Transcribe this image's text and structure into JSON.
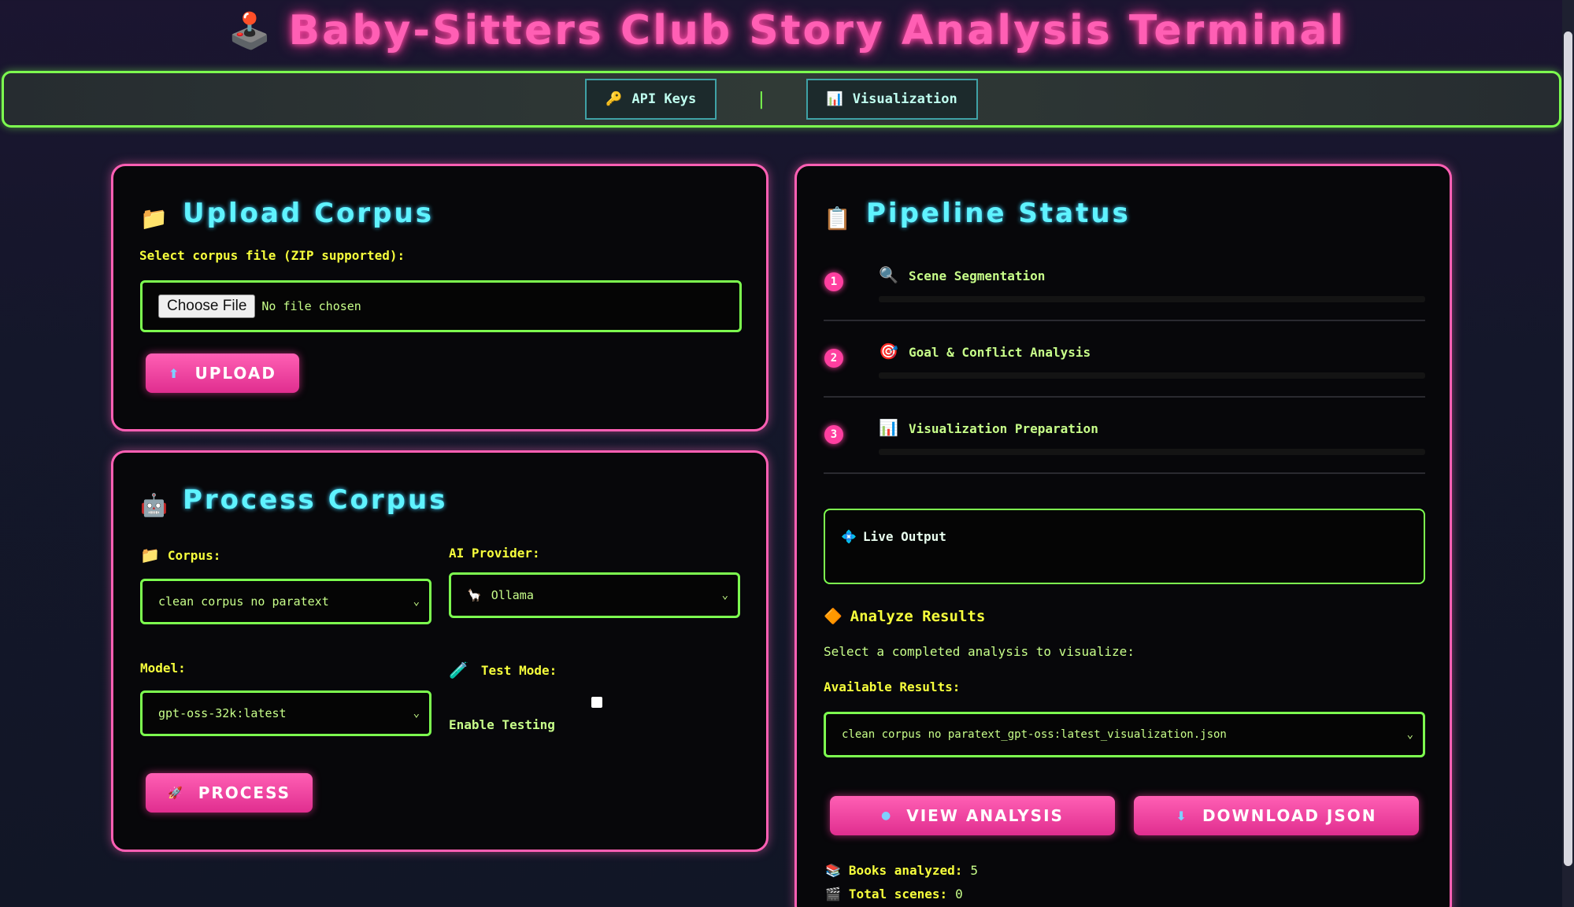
{
  "header": {
    "title": "Baby-Sitters Club Story Analysis Terminal",
    "icon": "🕹️"
  },
  "nav": {
    "api_keys_icon": "🔑",
    "api_keys": "API Keys",
    "separator": "|",
    "visualization_icon": "📊",
    "visualization": "Visualization"
  },
  "upload": {
    "icon": "📁",
    "title": "Upload Corpus",
    "file_label": "Select corpus file (ZIP supported):",
    "choose_file": "Choose File",
    "no_file": "No file chosen",
    "button_icon": "⬆",
    "button": "UPLOAD"
  },
  "process": {
    "icon": "🤖",
    "title": "Process Corpus",
    "corpus_icon": "📁",
    "corpus_label": "Corpus:",
    "corpus_value": "clean corpus no paratext",
    "provider_label": "AI Provider:",
    "provider_icon": "🦙",
    "provider_value": "Ollama",
    "model_label": "Model:",
    "model_value": "gpt-oss-32k:latest",
    "test_icon": "🧪",
    "test_label": "Test Mode:",
    "enable_testing": "Enable Testing",
    "button_icon": "🚀",
    "button": "PROCESS"
  },
  "pipeline": {
    "icon": "📋",
    "title": "Pipeline Status",
    "steps": [
      {
        "num": "1",
        "icon": "🔍",
        "label": "Scene Segmentation"
      },
      {
        "num": "2",
        "icon": "🎯",
        "label": "Goal & Conflict Analysis"
      },
      {
        "num": "3",
        "icon": "📊",
        "label": "Visualization Preparation"
      }
    ],
    "live_icon": "💠",
    "live_output": "Live Output",
    "analyze_icon": "🔶",
    "analyze_title": "Analyze Results",
    "select_text": "Select a completed analysis to visualize:",
    "available_label": "Available Results:",
    "result_value": "clean corpus no paratext_gpt-oss:latest_visualization.json",
    "view_icon": "●",
    "view_button": "VIEW ANALYSIS",
    "download_icon": "⬇",
    "download_button": "DOWNLOAD JSON",
    "books_icon": "📚",
    "books_label": "Books analyzed:",
    "books_value": "5",
    "scenes_icon": "🎬",
    "scenes_label": "Total scenes:",
    "scenes_value": "0"
  },
  "colors": {
    "pink": "#ff5fb4",
    "green": "#7dff4f",
    "cyan": "#5ff3ff",
    "yellow": "#f7ff3c"
  }
}
